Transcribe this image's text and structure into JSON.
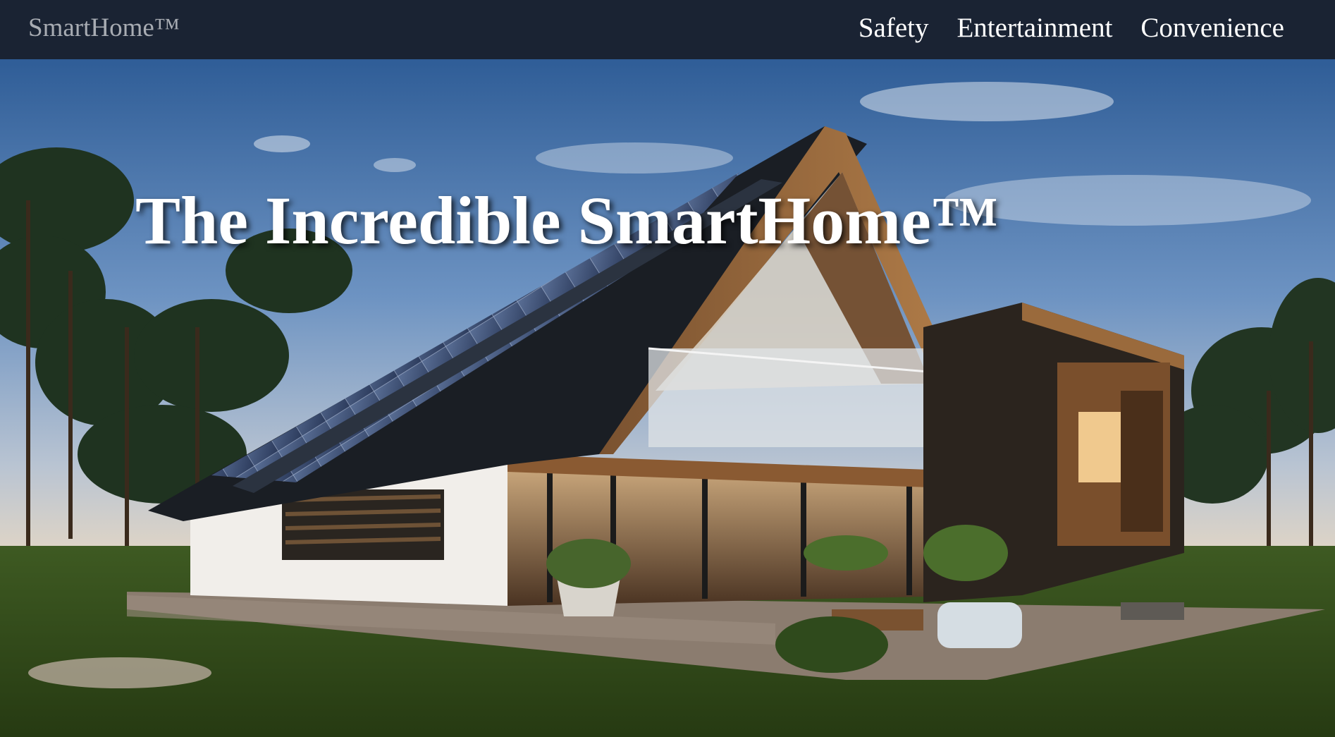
{
  "nav": {
    "brand": "SmartHome™",
    "links": [
      {
        "label": "Safety"
      },
      {
        "label": "Entertainment"
      },
      {
        "label": "Convenience"
      }
    ]
  },
  "hero": {
    "title": "The Incredible SmartHome™",
    "image": "modern-house-with-solar-roof"
  }
}
